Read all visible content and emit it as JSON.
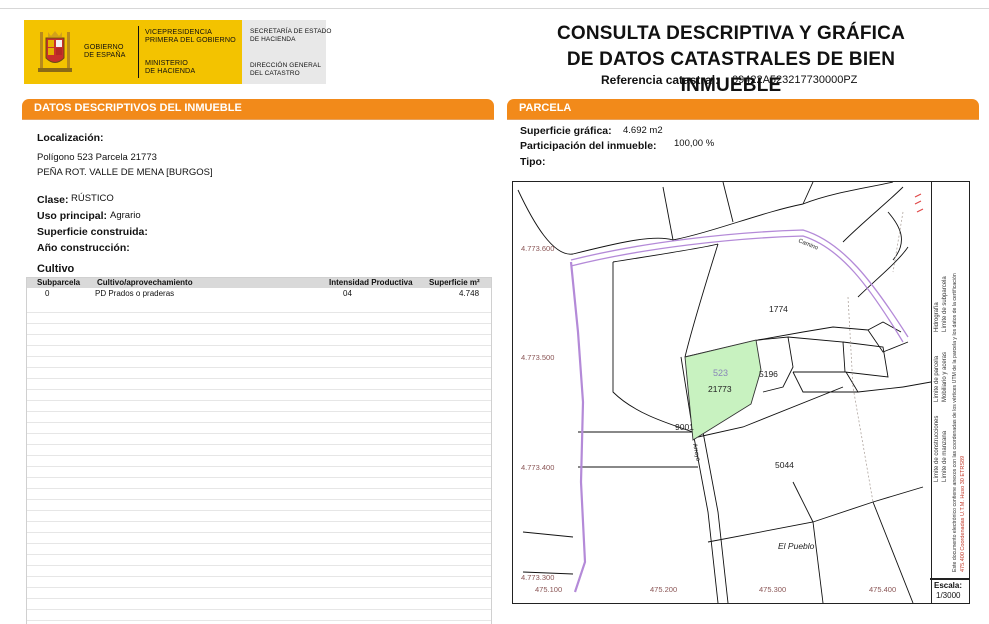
{
  "header": {
    "gobierno": "GOBIERNO\nDE ESPAÑA",
    "vicepresidencia": "VICEPRESIDENCIA\nPRIMERA DEL GOBIERNO",
    "ministerio": "MINISTERIO\nDE HACIENDA",
    "secretaria": "SECRETARÍA DE ESTADO\nDE HACIENDA",
    "direccion": "DIRECCIÓN GENERAL\nDEL CATASTRO",
    "title_line1": "CONSULTA DESCRIPTIVA Y GRÁFICA",
    "title_line2": "DE DATOS CATASTRALES DE BIEN INMUEBLE",
    "ref_label": "Referencia catastral:",
    "ref_value": "09422A523217730000PZ"
  },
  "descriptivos": {
    "section_title": "DATOS DESCRIPTIVOS DEL INMUEBLE",
    "localizacion_label": "Localización:",
    "localizacion_line1": "Polígono 523 Parcela 21773",
    "localizacion_line2": "PEÑA ROT. VALLE DE MENA [BURGOS]",
    "clase_label": "Clase:",
    "clase_value": "RÚSTICO",
    "uso_label": "Uso principal:",
    "uso_value": "Agrario",
    "superficie_construida_label": "Superficie construida:",
    "anio_label": "Año construcción:",
    "cultivo_label": "Cultivo",
    "table_headers": {
      "subparcela": "Subparcela",
      "cultivo": "Cultivo/aprovechamiento",
      "intensidad": "Intensidad Productiva",
      "superficie": "Superficie m²"
    },
    "rows": [
      {
        "subparcela": "0",
        "cultivo": "PD Prados o praderas",
        "intensidad": "04",
        "superficie": "4.748"
      }
    ]
  },
  "parcela": {
    "section_title": "PARCELA",
    "superficie_grafica_label": "Superficie gráfica:",
    "superficie_grafica_value": "4.692 m2",
    "participacion_label": "Participación del inmueble:",
    "participacion_value": "100,00 %",
    "tipo_label": "Tipo:"
  },
  "map": {
    "y_labels": [
      "4.773.600",
      "4.773.500",
      "4.773.400",
      "4.773.300"
    ],
    "x_labels": [
      "475.100",
      "475.200",
      "475.300",
      "475.400"
    ],
    "parcel_numbers": [
      "1774",
      "523",
      "21773",
      "5196",
      "9001",
      "5044"
    ],
    "place_name": "El Pueblo",
    "road_labels": [
      "Camino",
      "Arroyo"
    ],
    "legend": {
      "hidrografia": "Hidrografía",
      "limite_parcela": "Límite de parcela",
      "limite_subparcela": "Límite de subparcela",
      "mobiliario": "Mobiliario y aceras",
      "limite_construcciones": "Límite de construcciones",
      "limite_manzana": "Límite de manzana",
      "note": "Este documento electrónico contiene anexos con las coordenadas de los vértices UTM de la parcela y los datos de la certificación",
      "coords": "475.400 Coordenadas U.T.M. Huso 30 ETRS89"
    },
    "scale_label": "Escala:",
    "scale_value": "1/3000"
  },
  "colors": {
    "accent_orange": "#f28a1a",
    "logo_yellow": "#f3c300",
    "parcel_green": "#c8f2c0",
    "boundary_purple": "#b48ad8"
  }
}
